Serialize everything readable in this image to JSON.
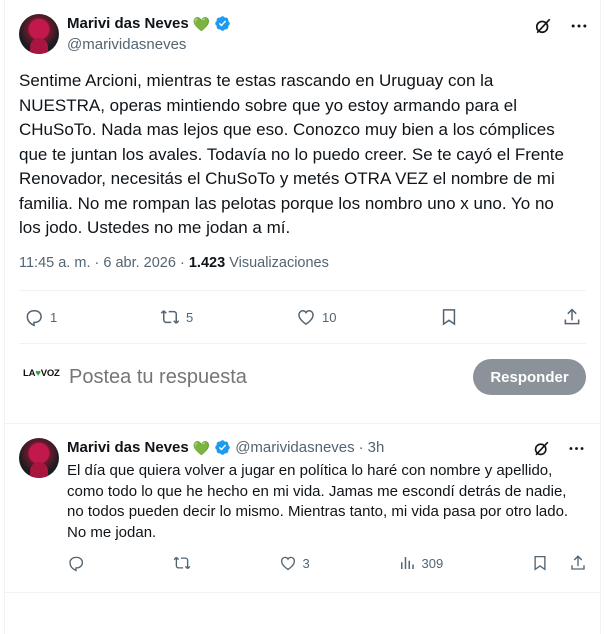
{
  "post": {
    "author_name": "Marivi das Neves",
    "heart": "💚",
    "handle": "@marividasneves",
    "text": "Sentime Arcioni, mientras te estas rascando en Uruguay con la NUESTRA, operas mintiendo sobre que yo estoy armando para el CHuSoTo. Nada mas lejos que eso. Conozco muy bien a los cómplices que te juntan los avales. Todavía no lo puedo creer. Se te cayó el Frente Renovador, necesitás el ChuSoTo y metés OTRA VEZ el nombre de mi familia. No me rompan las pelotas porque los nombro uno x uno. Yo no los jodo. Ustedes no me jodan a mí.",
    "time": "11:45 a. m.",
    "separator": "·",
    "date": "6 abr. 2026",
    "views_count": "1.423",
    "views_label": "Visualizaciones",
    "replies": "1",
    "reposts": "5",
    "likes": "10"
  },
  "reply_composer": {
    "logo_left": "LA",
    "logo_mid": "♥",
    "logo_right": "VOZ",
    "placeholder": "Postea tu respuesta",
    "button_label": "Responder"
  },
  "reply": {
    "author_name": "Marivi das Neves",
    "heart": "💚",
    "handle": "@marividasneves",
    "separator": "·",
    "age": "3h",
    "text": "El día que quiera volver a jugar en política lo haré con nombre y apellido, como todo lo que he hecho en mi vida. Jamas me escondí detrás de nadie, no todos pueden decir lo mismo. Mientras tanto, mi vida pasa por otro lado. No me jodan.",
    "likes": "3",
    "views": "309"
  },
  "colors": {
    "verified_blue": "#1d9bf0",
    "heart_green": "#4caf3f",
    "muted_text": "#536471",
    "button_disabled": "#8b9299"
  },
  "icons": [
    "grok-icon",
    "more-icon",
    "reply-icon",
    "repost-icon",
    "like-icon",
    "bookmark-icon",
    "share-icon",
    "views-icon",
    "verified-icon"
  ]
}
